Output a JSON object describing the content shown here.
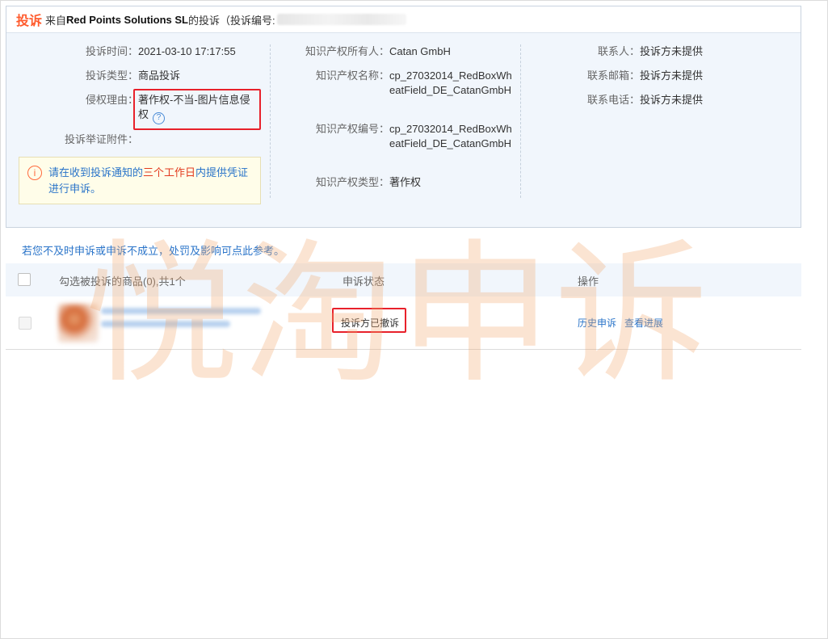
{
  "header": {
    "title": "投诉",
    "from": "来自",
    "company": "Red Points Solutions SL",
    "suffix": "的投诉（投诉编号:"
  },
  "details": {
    "left": [
      {
        "label": "投诉时间：",
        "value": "2021-03-10 17:17:55"
      },
      {
        "label": "投诉类型：",
        "value": "商品投诉"
      },
      {
        "label": "侵权理由：",
        "value": "著作权-不当-图片信息侵权"
      },
      {
        "label": "投诉举证附件：",
        "value": ""
      }
    ],
    "middle": [
      {
        "label": "知识产权所有人：",
        "value": "Catan GmbH"
      },
      {
        "label": "知识产权名称：",
        "value": "cp_27032014_RedBoxWheatField_DE_CatanGmbH"
      },
      {
        "label": "知识产权编号：",
        "value": "cp_27032014_RedBoxWheatField_DE_CatanGmbH"
      },
      {
        "label": "知识产权类型：",
        "value": "著作权"
      }
    ],
    "right": [
      {
        "label": "联系人：",
        "value": "投诉方未提供"
      },
      {
        "label": "联系邮箱：",
        "value": "投诉方未提供"
      },
      {
        "label": "联系电话：",
        "value": "投诉方未提供"
      }
    ],
    "help_icon": "question-circle-icon"
  },
  "notice": {
    "icon": "info-circle-icon",
    "text_before": "请在收到投诉通知的",
    "text_emphasis": "三个工作日",
    "text_after": "内提供凭证进行申诉。"
  },
  "reference_link": "若您不及时申诉或申诉不成立，处罚及影响可点此参考。",
  "table": {
    "headers": {
      "product": "勾选被投诉的商品(0),共1个",
      "status": "申诉状态",
      "actions": "操作"
    },
    "rows": [
      {
        "status": "投诉方已撤诉",
        "actions": [
          "历史申诉",
          "查看进展"
        ]
      }
    ]
  },
  "watermark": "悦淘申诉",
  "colors": {
    "accent_orange": "#ff5b2d",
    "link_blue": "#2a74c9",
    "highlight_red": "#e8212b",
    "panel_bg": "#f1f6fc",
    "notice_bg": "#fffde9"
  }
}
